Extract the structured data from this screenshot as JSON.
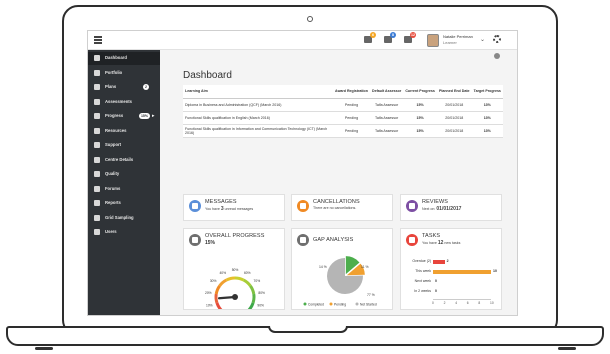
{
  "topbar": {
    "notifications": [
      {
        "icon": "bell-icon",
        "badge": "6",
        "color": "#f5a623"
      },
      {
        "icon": "chat-icon",
        "badge": "8",
        "color": "#3a7bd5"
      },
      {
        "icon": "calendar-icon",
        "badge": "12",
        "color": "#e74c3c"
      }
    ],
    "user_name": "Natalie Perriman",
    "user_role": "Learner"
  },
  "sidebar": {
    "items": [
      {
        "label": "Dashboard",
        "icon": "home-icon"
      },
      {
        "label": "Portfolio",
        "icon": "folder-icon"
      },
      {
        "label": "Plans",
        "icon": "plan-icon",
        "pill": "2"
      },
      {
        "label": "Assessments",
        "icon": "assessment-icon"
      },
      {
        "label": "Progress",
        "icon": "chart-icon",
        "pill": "15%"
      },
      {
        "label": "Resources",
        "icon": "resources-icon"
      },
      {
        "label": "Support",
        "icon": "support-icon"
      },
      {
        "label": "Centre Details",
        "icon": "building-icon"
      },
      {
        "label": "Quality",
        "icon": "quality-icon"
      },
      {
        "label": "Forums",
        "icon": "forum-icon"
      },
      {
        "label": "Reports",
        "icon": "report-icon"
      },
      {
        "label": "Grid Sampling",
        "icon": "grid-icon"
      },
      {
        "label": "Users",
        "icon": "users-icon"
      }
    ]
  },
  "main": {
    "title": "Dashboard",
    "table": {
      "headers": [
        "Learning Aim",
        "Award Registration",
        "Default Assessor",
        "Current Progress",
        "Planned End Date",
        "Target Progress"
      ],
      "rows": [
        [
          "Diploma in Business and Administration (QCF) (March 2016)",
          "Pending",
          "Talfa Assessor",
          "15%",
          "20/01/2018",
          "13%"
        ],
        [
          "Functional Skills qualification in English (March 2016)",
          "Pending",
          "Talfa Assessor",
          "15%",
          "20/01/2018",
          "13%"
        ],
        [
          "Functional Skills qualification in Information and Communication Technology (ICT) (March 2016)",
          "Pending",
          "Talfa Assessor",
          "15%",
          "20/01/2018",
          "13%"
        ]
      ]
    },
    "messages": {
      "title": "MESSAGES",
      "text_before": "You have ",
      "count": "3",
      "text_after": " unread messages"
    },
    "cancellations": {
      "title": "CANCELLATIONS",
      "text": "There are no cancellations."
    },
    "reviews": {
      "title": "REVIEWS",
      "text_prefix": "Next on: ",
      "date": "01/01/2017"
    },
    "overall_progress": {
      "title": "OVERALL PROGRESS",
      "value": "15%",
      "progress": 0.15,
      "gauge_ticks": [
        "0%",
        "10%",
        "20%",
        "30%",
        "40%",
        "50%",
        "60%",
        "70%",
        "80%",
        "90%",
        "100%"
      ]
    },
    "gap_analysis": {
      "title": "GAP ANALYSIS",
      "labels": [
        "14 %",
        "11 %",
        "77 %"
      ],
      "legend": [
        "Completed",
        "Pending",
        "Not Started"
      ]
    },
    "tasks": {
      "title": "TASKS",
      "text_before": "You have ",
      "count": "12",
      "text_after": " new tasks",
      "rows": [
        {
          "label": "Overdue (2)",
          "value": "2"
        },
        {
          "label": "This week",
          "value": "10"
        },
        {
          "label": "Next week",
          "value": "0"
        },
        {
          "label": "In 2 weeks",
          "value": "0"
        }
      ],
      "axis": [
        "0",
        "2",
        "4",
        "6",
        "8",
        "10"
      ]
    }
  },
  "colors": {
    "messages": "#5b8fd9",
    "cancellations": "#f08a24",
    "reviews": "#7d4fa3",
    "progress": "#6f6f6f",
    "gap": "#6f6f6f",
    "tasks": "#e8453c",
    "completed": "#4cae4c",
    "pending": "#f0a030",
    "not_started": "#b5b5b5"
  },
  "chart_data": {
    "type": "pie",
    "categories": [
      "Completed",
      "Pending",
      "Not Started"
    ],
    "values": [
      14,
      11,
      77
    ]
  }
}
